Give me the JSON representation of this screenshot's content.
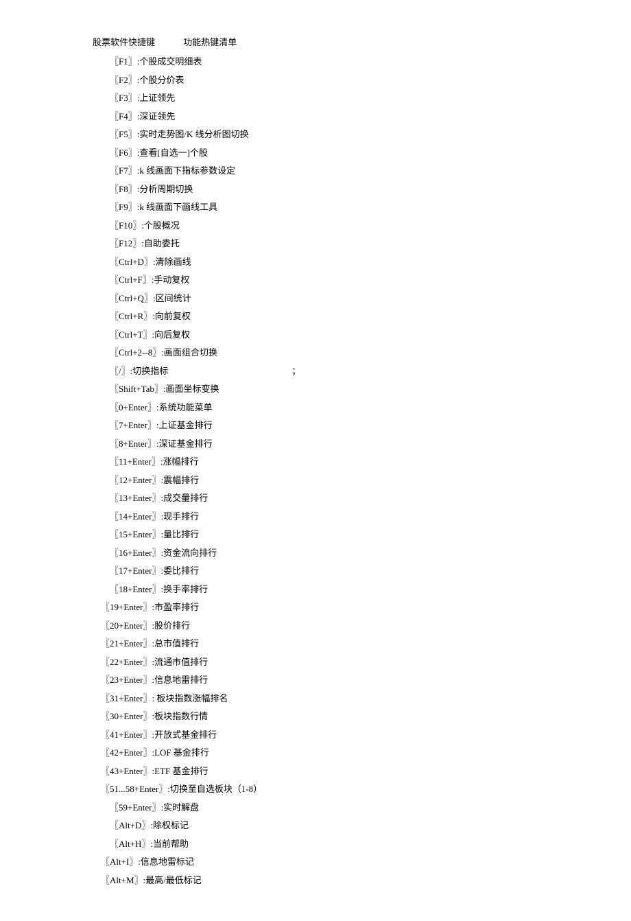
{
  "header": {
    "title": "股票软件快捷键",
    "subtitle": "功能热键清单"
  },
  "items": [
    {
      "indent": 1,
      "key": "〖F1〗",
      "desc": ":个股成交明细表"
    },
    {
      "indent": 1,
      "key": "〖F2〗",
      "desc": ":个股分价表"
    },
    {
      "indent": 1,
      "key": "〖F3〗",
      "desc": ":上证领先"
    },
    {
      "indent": 1,
      "key": "〖F4〗",
      "desc": ":深证领先"
    },
    {
      "indent": 1,
      "key": "〖F5〗",
      "desc": ":实时走势图/K 线分析图切换"
    },
    {
      "indent": 1,
      "key": "〖F6〗",
      "desc": ":查看[自选一]个股"
    },
    {
      "indent": 1,
      "key": "〖F7〗",
      "desc": ":k 线画面下指标参数设定"
    },
    {
      "indent": 1,
      "key": "〖F8〗",
      "desc": ":分析周期切换"
    },
    {
      "indent": 1,
      "key": "〖F9〗",
      "desc": ":k 线画面下画线工具"
    },
    {
      "indent": 1,
      "key": "〖F10〗",
      "desc": ":个股概况"
    },
    {
      "indent": 1,
      "key": "〖F12〗",
      "desc": ":自助委托"
    },
    {
      "indent": 1,
      "key": "〖Ctrl+D〗",
      "desc": ":清除画线"
    },
    {
      "indent": 1,
      "key": "〖Ctrl+F〗",
      "desc": ":手动复权"
    },
    {
      "indent": 1,
      "key": "〖Ctrl+Q〗",
      "desc": ":区间统计"
    },
    {
      "indent": 1,
      "key": "〖Ctrl+R〗",
      "desc": ":向前复权"
    },
    {
      "indent": 1,
      "key": "〖Ctrl+T〗",
      "desc": ":向后复权"
    },
    {
      "indent": 1,
      "key": "〖Ctrl+2--8〗",
      "desc": ":画面组合切换"
    },
    {
      "indent": 1,
      "key": "〖/〗",
      "desc": ":切换指标",
      "extra": "；"
    },
    {
      "indent": 1,
      "key": "〖Shift+Tab〗",
      "desc": ":画面坐标变换"
    },
    {
      "indent": 1,
      "key": "〖0+Enter〗",
      "desc": ":系统功能菜单"
    },
    {
      "indent": 1,
      "key": "〖7+Enter〗",
      "desc": ":上证基金排行"
    },
    {
      "indent": 1,
      "key": "〖8+Enter〗",
      "desc": ":深证基金排行"
    },
    {
      "indent": 1,
      "key": "〖11+Enter〗",
      "desc": ":涨幅排行"
    },
    {
      "indent": 1,
      "key": "〖12+Enter〗",
      "desc": ":震幅排行"
    },
    {
      "indent": 1,
      "key": "〖13+Enter〗",
      "desc": ":成交量排行"
    },
    {
      "indent": 1,
      "key": "〖14+Enter〗",
      "desc": ":现手排行"
    },
    {
      "indent": 1,
      "key": "〖15+Enter〗",
      "desc": ":量比排行"
    },
    {
      "indent": 1,
      "key": "〖16+Enter〗",
      "desc": ":资金流向排行"
    },
    {
      "indent": 1,
      "key": "〖17+Enter〗",
      "desc": ":委比排行"
    },
    {
      "indent": 1,
      "key": "〖18+Enter〗",
      "desc": ":换手率排行"
    },
    {
      "indent": 0,
      "key": "〖19+Enter〗",
      "desc": ":市盈率排行"
    },
    {
      "indent": 0,
      "key": "〖20+Enter〗",
      "desc": ":股价排行"
    },
    {
      "indent": 0,
      "key": "〖21+Enter〗",
      "desc": ":总市值排行"
    },
    {
      "indent": 0,
      "key": "〖22+Enter〗",
      "desc": ":流通市值排行"
    },
    {
      "indent": 0,
      "key": "〖23+Enter〗",
      "desc": ":信息地雷排行"
    },
    {
      "indent": 0,
      "key": "〖31+Enter〗",
      "desc": ": 板块指数涨幅排名"
    },
    {
      "indent": 0,
      "key": "〖30+Enter〗",
      "desc": ":板块指数行情"
    },
    {
      "indent": 0,
      "key": "〖41+Enter〗",
      "desc": ":开放式基金排行"
    },
    {
      "indent": 0,
      "key": "〖42+Enter〗",
      "desc": ":LOF 基金排行"
    },
    {
      "indent": 0,
      "key": "〖43+Enter〗",
      "desc": ":ETF 基金排行"
    },
    {
      "indent": 0,
      "key": "〖51...58+Enter〗",
      "desc": ":切换至自选板块（1-8）"
    },
    {
      "indent": 1,
      "key": "〖59+Enter〗",
      "desc": ":实时解盘"
    },
    {
      "indent": 1,
      "key": "〖Alt+D〗",
      "desc": ":除权标记"
    },
    {
      "indent": 1,
      "key": "〖Alt+H〗",
      "desc": ":当前帮助"
    },
    {
      "indent": 0,
      "key": "〖Alt+I〗",
      "desc": ":信息地雷标记"
    },
    {
      "indent": 0,
      "key": "〖Alt+M〗",
      "desc": ":最高/最低标记"
    }
  ]
}
